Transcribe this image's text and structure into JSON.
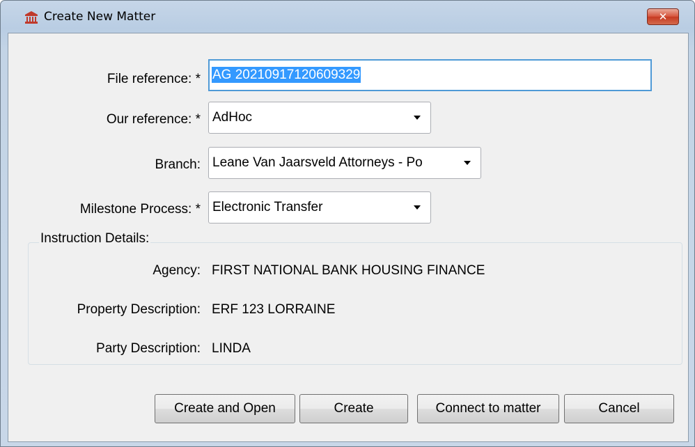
{
  "window": {
    "title": "Create New Matter",
    "close_glyph": "✕"
  },
  "form": {
    "file_reference": {
      "label": "File reference: *",
      "value": "AG 20210917120609329"
    },
    "our_reference": {
      "label": "Our reference: *",
      "value": "AdHoc"
    },
    "branch": {
      "label": "Branch:",
      "value": "Leane Van Jaarsveld Attorneys - Po"
    },
    "milestone_process": {
      "label": "Milestone Process: *",
      "value": "Electronic Transfer"
    }
  },
  "instruction_details": {
    "title": "Instruction Details:",
    "agency": {
      "label": "Agency:",
      "value": "FIRST NATIONAL BANK HOUSING FINANCE"
    },
    "property_description": {
      "label": "Property Description:",
      "value": "ERF 123 LORRAINE"
    },
    "party_description": {
      "label": "Party Description:",
      "value": "LINDA"
    }
  },
  "buttons": {
    "create_and_open": "Create and Open",
    "create": "Create",
    "connect_to_matter": "Connect to matter",
    "cancel": "Cancel"
  },
  "icons": {
    "app": "building-columns-icon",
    "close": "close-icon",
    "dropdown": "chevron-down-icon"
  },
  "colors": {
    "app_icon": "#c0392b",
    "close_button": "#c63a22",
    "selection": "#3399ff",
    "focus_border": "#4f9ad6"
  }
}
